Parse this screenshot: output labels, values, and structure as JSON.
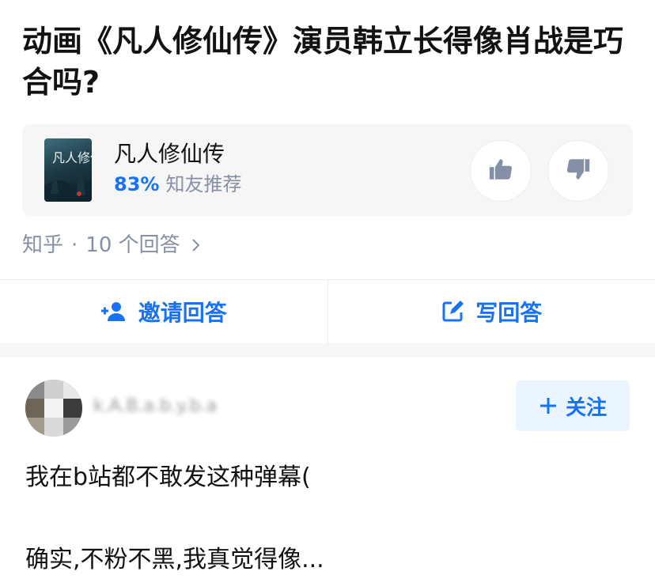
{
  "question": {
    "title": "动画《凡人修仙传》演员韩立长得像肖战是巧合吗?"
  },
  "media_card": {
    "name": "凡人修仙传",
    "recommend_percent": "83%",
    "recommend_label": "知友推荐",
    "cover_title": "凡人修仙传"
  },
  "meta": {
    "source": "知乎",
    "separator": "·",
    "answer_count": "10 个回答"
  },
  "actions": {
    "invite_label": "邀请回答",
    "write_label": "写回答"
  },
  "answer": {
    "author": "k.A.B.a.b.y.b.a",
    "follow_label": "关注",
    "line1": "我在b站都不敢发这种弹幕(",
    "line2": "确实,不粉不黑,我真觉得像..."
  },
  "colors": {
    "accent": "#1772f6",
    "muted": "#8590a6",
    "card_bg": "#f6f6f6",
    "follow_bg": "#ebf5ff"
  },
  "icons": {
    "thumb_up": "thumb-up-icon",
    "thumb_down": "thumb-down-icon",
    "invite": "add-person-icon",
    "write": "edit-icon",
    "chevron": "chevron-right-icon",
    "plus": "plus-icon"
  }
}
